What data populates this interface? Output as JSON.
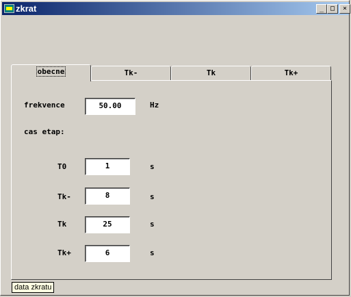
{
  "window": {
    "title": "zkrat",
    "buttons": {
      "minimize": "_",
      "maximize": "□",
      "close": "×"
    }
  },
  "tabs": [
    {
      "label": "obecne",
      "active": true
    },
    {
      "label": "Tk-",
      "active": false
    },
    {
      "label": "Tk",
      "active": false
    },
    {
      "label": "Tk+",
      "active": false
    }
  ],
  "form": {
    "frequency": {
      "label": "frekvence",
      "value": "50.00",
      "unit": "Hz"
    },
    "stages_heading": "cas etap:",
    "stages": [
      {
        "label": "T0",
        "value": "1",
        "unit": "s"
      },
      {
        "label": "Tk-",
        "value": "8",
        "unit": "s"
      },
      {
        "label": "Tk",
        "value": "25",
        "unit": "s"
      },
      {
        "label": "Tk+",
        "value": "6",
        "unit": "s"
      }
    ]
  },
  "tooltip": "data zkratu",
  "colors": {
    "titlebar_start": "#0a246a",
    "titlebar_end": "#a6caf0",
    "face": "#d4d0c8",
    "tooltip_bg": "#ffffe1"
  }
}
